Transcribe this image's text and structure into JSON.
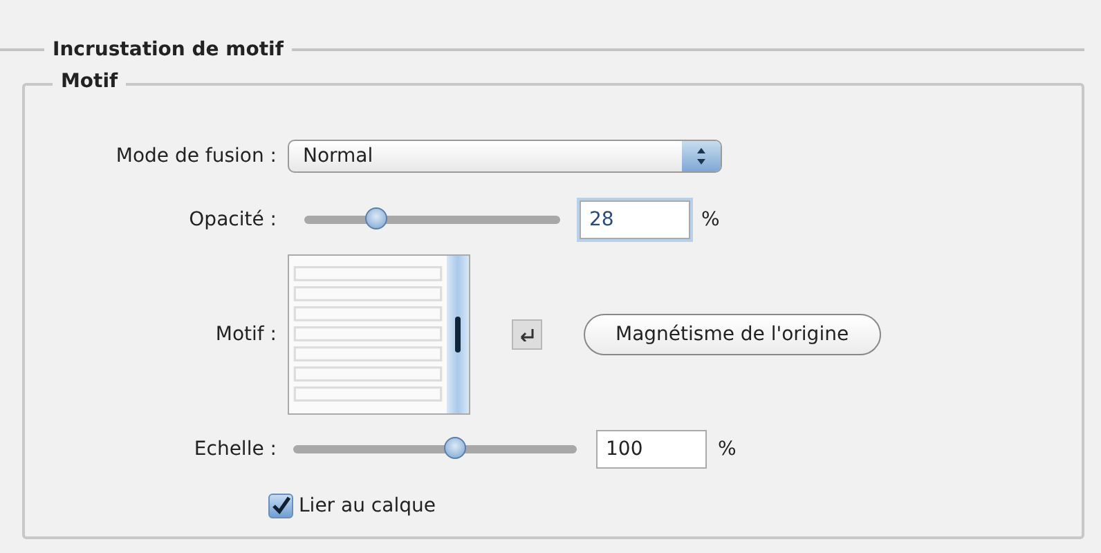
{
  "section_title": "Incrustation de motif",
  "group_title": "Motif",
  "blend_mode": {
    "label": "Mode de fusion :",
    "value": "Normal"
  },
  "opacity": {
    "label": "Opacité :",
    "level": 0.28,
    "value": "28",
    "unit": "%"
  },
  "pattern": {
    "label": "Motif :",
    "kind": "picture",
    "button": "Magnétisme de l'origine"
  },
  "scale": {
    "label": "Echelle :",
    "level": 0.57,
    "value": "100",
    "unit": "%"
  },
  "link_layer": {
    "label": "Lier au calque",
    "checked": true
  }
}
